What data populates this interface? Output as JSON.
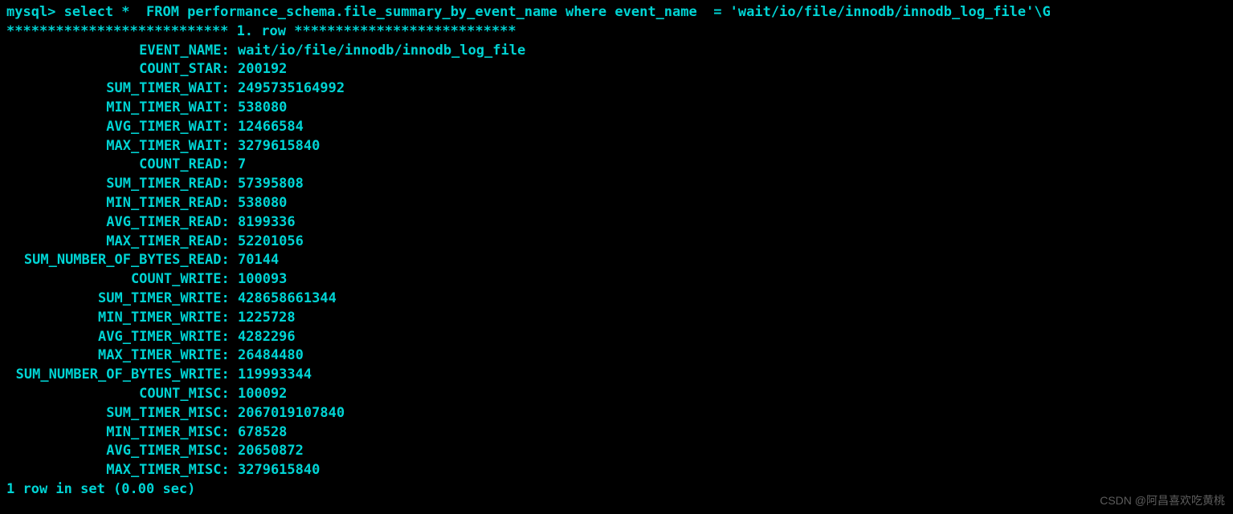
{
  "prompt": "mysql> ",
  "command": "select *  FROM performance_schema.file_summary_by_event_name where event_name  = 'wait/io/file/innodb/innodb_log_file'\\G",
  "row_header": "*************************** 1. row ***************************",
  "fields": [
    {
      "name": "EVENT_NAME",
      "value": "wait/io/file/innodb/innodb_log_file"
    },
    {
      "name": "COUNT_STAR",
      "value": "200192"
    },
    {
      "name": "SUM_TIMER_WAIT",
      "value": "2495735164992"
    },
    {
      "name": "MIN_TIMER_WAIT",
      "value": "538080"
    },
    {
      "name": "AVG_TIMER_WAIT",
      "value": "12466584"
    },
    {
      "name": "MAX_TIMER_WAIT",
      "value": "3279615840"
    },
    {
      "name": "COUNT_READ",
      "value": "7"
    },
    {
      "name": "SUM_TIMER_READ",
      "value": "57395808"
    },
    {
      "name": "MIN_TIMER_READ",
      "value": "538080"
    },
    {
      "name": "AVG_TIMER_READ",
      "value": "8199336"
    },
    {
      "name": "MAX_TIMER_READ",
      "value": "52201056"
    },
    {
      "name": "SUM_NUMBER_OF_BYTES_READ",
      "value": "70144"
    },
    {
      "name": "COUNT_WRITE",
      "value": "100093"
    },
    {
      "name": "SUM_TIMER_WRITE",
      "value": "428658661344"
    },
    {
      "name": "MIN_TIMER_WRITE",
      "value": "1225728"
    },
    {
      "name": "AVG_TIMER_WRITE",
      "value": "4282296"
    },
    {
      "name": "MAX_TIMER_WRITE",
      "value": "26484480"
    },
    {
      "name": "SUM_NUMBER_OF_BYTES_WRITE",
      "value": "119993344"
    },
    {
      "name": "COUNT_MISC",
      "value": "100092"
    },
    {
      "name": "SUM_TIMER_MISC",
      "value": "2067019107840"
    },
    {
      "name": "MIN_TIMER_MISC",
      "value": "678528"
    },
    {
      "name": "AVG_TIMER_MISC",
      "value": "20650872"
    },
    {
      "name": "MAX_TIMER_MISC",
      "value": "3279615840"
    }
  ],
  "footer": "1 row in set (0.00 sec)",
  "watermark": "CSDN @阿昌喜欢吃黄桃",
  "label_width": 25
}
